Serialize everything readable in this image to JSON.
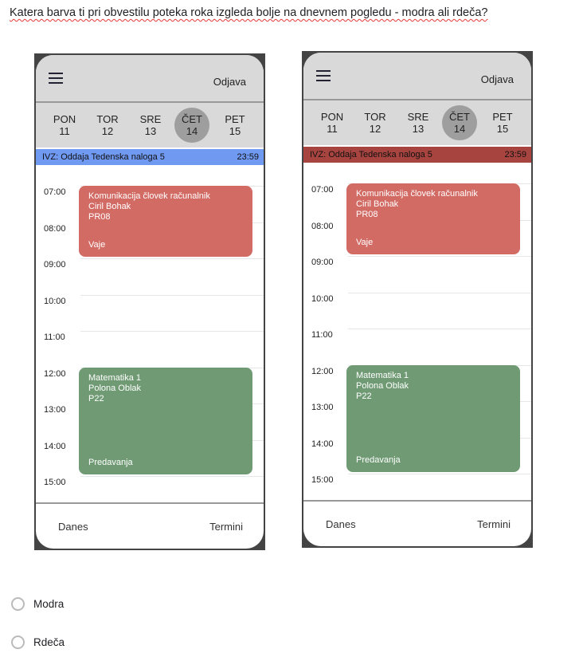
{
  "question": "Katera barva ti pri obvestilu poteka roka izgleda bolje na dnevnem pogledu - modra ali rdeča?",
  "phones": [
    {
      "variant": "blue",
      "deadline_color": "#7099f2"
    },
    {
      "variant": "red",
      "deadline_color": "#a8443f"
    }
  ],
  "app": {
    "logout_label": "Odjava",
    "days": [
      {
        "name": "PON",
        "date": "11"
      },
      {
        "name": "TOR",
        "date": "12"
      },
      {
        "name": "SRE",
        "date": "13"
      },
      {
        "name": "ČET",
        "date": "14",
        "selected": true
      },
      {
        "name": "PET",
        "date": "15"
      }
    ],
    "deadline": {
      "title": "IVZ: Oddaja Tedenska naloga 5",
      "time": "23:59"
    },
    "hours": [
      "07:00",
      "08:00",
      "09:00",
      "10:00",
      "11:00",
      "12:00",
      "13:00",
      "14:00",
      "15:00"
    ],
    "events": [
      {
        "title": "Komunikacija človek računalnik",
        "teacher": "Ciril Bohak",
        "room": "PR08",
        "type": "Vaje",
        "start": 7,
        "end": 9,
        "color": "#d36b65"
      },
      {
        "title": "Matematika 1",
        "teacher": "Polona Oblak",
        "room": "P22",
        "type": "Predavanja",
        "start": 12,
        "end": 15,
        "color": "#6f9a74"
      }
    ],
    "footer": {
      "today": "Danes",
      "appointments": "Termini"
    }
  },
  "options": [
    "Modra",
    "Rdeča"
  ]
}
